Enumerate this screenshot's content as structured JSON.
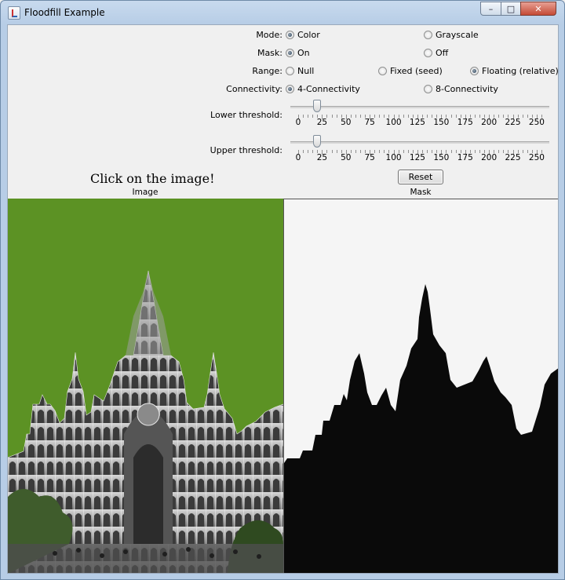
{
  "window": {
    "title": "Floodfill Example",
    "controls": {
      "minimize": "–",
      "maximize": "□",
      "close": "✕"
    }
  },
  "mode": {
    "label": "Mode:",
    "options": [
      "Color",
      "Grayscale"
    ],
    "selected": "Color"
  },
  "mask": {
    "label": "Mask:",
    "options": [
      "On",
      "Off"
    ],
    "selected": "On"
  },
  "range": {
    "label": "Range:",
    "options": [
      "Null",
      "Fixed (seed)",
      "Floating (relative)"
    ],
    "selected": "Floating (relative)"
  },
  "connectivity": {
    "label": "Connectivity:",
    "options": [
      "4-Connectivity",
      "8-Connectivity"
    ],
    "selected": "4-Connectivity"
  },
  "lower_threshold": {
    "label": "Lower threshold:",
    "value": 20,
    "min": 0,
    "max": 255
  },
  "upper_threshold": {
    "label": "Upper threshold:",
    "value": 20,
    "min": 0,
    "max": 255
  },
  "slider_ticks": [
    "0",
    "25",
    "50",
    "75",
    "100",
    "125",
    "150",
    "175",
    "200",
    "225",
    "250"
  ],
  "instruction": "Click on the image!",
  "reset_label": "Reset",
  "image_caption": "Image",
  "mask_caption": "Mask",
  "colors": {
    "fill": "#5c9224",
    "mask_bg": "#f5f5f5",
    "mask_fg": "#0a0a0a"
  }
}
